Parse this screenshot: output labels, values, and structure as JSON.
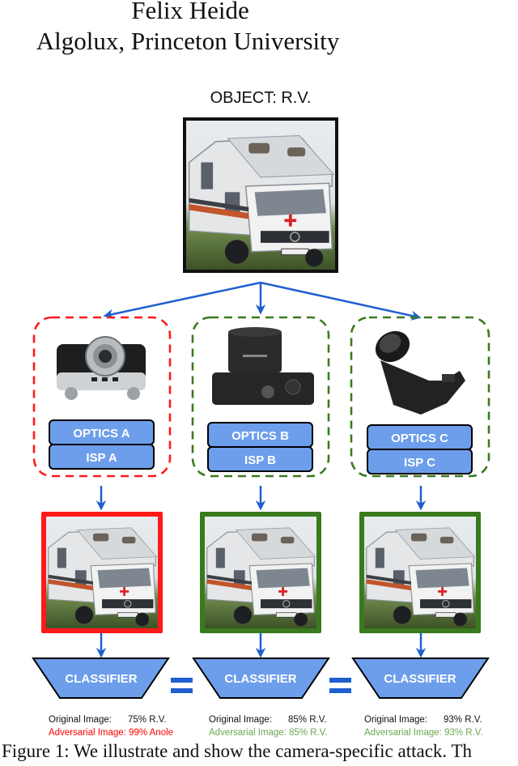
{
  "header": {
    "author": "Felix Heide",
    "affiliation": "Algolux, Princeton University"
  },
  "object_label": "OBJECT: R.V.",
  "colors": {
    "arrow": "#1f5fcf",
    "box_fill": "#6d9eeb",
    "attack_success": "#ff1a1a",
    "attack_fail": "#3a7a1e",
    "adv_success_text": "#ff0000",
    "adv_fail_text": "#6aa84f"
  },
  "cameras": [
    {
      "optics_label": "OPTICS A",
      "isp_label": "ISP A",
      "camera_icon": "rangefinder-camera-icon",
      "status": "attacked",
      "classifier_label": "CLASSIFIER",
      "result": {
        "original_key": "Original Image:",
        "original_value": "75% R.V.",
        "adversarial_key": "Adversarial Image:",
        "adversarial_value": "99% Anole"
      }
    },
    {
      "optics_label": "OPTICS B",
      "isp_label": "ISP B",
      "camera_icon": "mirrorless-camera-icon",
      "status": "robust",
      "classifier_label": "CLASSIFIER",
      "result": {
        "original_key": "Original Image:",
        "original_value": "85% R.V.",
        "adversarial_key": "Adversarial Image:",
        "adversarial_value": "85% R.V."
      }
    },
    {
      "optics_label": "OPTICS C",
      "isp_label": "ISP C",
      "camera_icon": "dslr-camera-icon",
      "status": "robust",
      "classifier_label": "CLASSIFIER",
      "result": {
        "original_key": "Original Image:",
        "original_value": "93% R.V.",
        "adversarial_key": "Adversarial Image:",
        "adversarial_value": "93% R.V."
      }
    }
  ],
  "equals_symbol": "=",
  "caption": "Figure 1: We illustrate and show the camera-specific attack. Th"
}
